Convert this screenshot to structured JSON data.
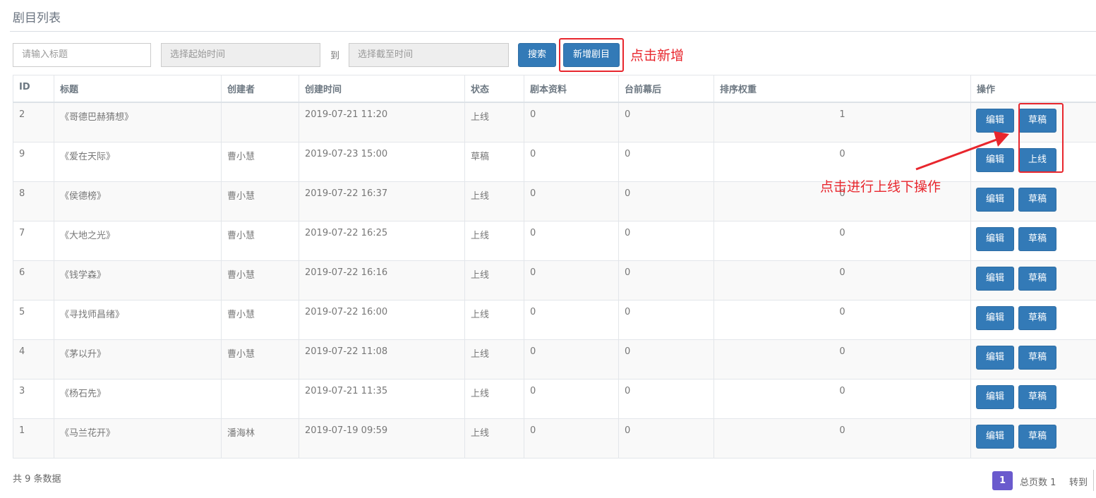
{
  "page": {
    "title": "剧目列表"
  },
  "search": {
    "title_placeholder": "请输入标题",
    "start_placeholder": "选择起始时间",
    "to_label": "到",
    "end_placeholder": "选择截至时间",
    "search_label": "搜索",
    "add_label": "新增剧目"
  },
  "annotations": {
    "add_note": "点击新增",
    "status_note": "点击进行上线下操作",
    "color": "#e8262d"
  },
  "table": {
    "headers": [
      "ID",
      "标题",
      "创建者",
      "创建时间",
      "状态",
      "剧本资料",
      "台前幕后",
      "排序权重",
      "操作"
    ],
    "rows": [
      {
        "id": "2",
        "title": "《哥德巴赫猜想》",
        "creator": "",
        "created": "2019-07-21 11:20",
        "status": "上线",
        "script": "0",
        "backstage": "0",
        "weight": "1",
        "edit": "编辑",
        "toggle": "草稿"
      },
      {
        "id": "9",
        "title": "《爱在天际》",
        "creator": "曹小慧",
        "created": "2019-07-23 15:00",
        "status": "草稿",
        "script": "0",
        "backstage": "0",
        "weight": "0",
        "edit": "编辑",
        "toggle": "上线"
      },
      {
        "id": "8",
        "title": "《侯德榜》",
        "creator": "曹小慧",
        "created": "2019-07-22 16:37",
        "status": "上线",
        "script": "0",
        "backstage": "0",
        "weight": "0",
        "edit": "编辑",
        "toggle": "草稿"
      },
      {
        "id": "7",
        "title": "《大地之光》",
        "creator": "曹小慧",
        "created": "2019-07-22 16:25",
        "status": "上线",
        "script": "0",
        "backstage": "0",
        "weight": "0",
        "edit": "编辑",
        "toggle": "草稿"
      },
      {
        "id": "6",
        "title": "《钱学森》",
        "creator": "曹小慧",
        "created": "2019-07-22 16:16",
        "status": "上线",
        "script": "0",
        "backstage": "0",
        "weight": "0",
        "edit": "编辑",
        "toggle": "草稿"
      },
      {
        "id": "5",
        "title": "《寻找师昌绪》",
        "creator": "曹小慧",
        "created": "2019-07-22 16:00",
        "status": "上线",
        "script": "0",
        "backstage": "0",
        "weight": "0",
        "edit": "编辑",
        "toggle": "草稿"
      },
      {
        "id": "4",
        "title": "《茅以升》",
        "creator": "曹小慧",
        "created": "2019-07-22 11:08",
        "status": "上线",
        "script": "0",
        "backstage": "0",
        "weight": "0",
        "edit": "编辑",
        "toggle": "草稿"
      },
      {
        "id": "3",
        "title": "《杨石先》",
        "creator": "",
        "created": "2019-07-21 11:35",
        "status": "上线",
        "script": "0",
        "backstage": "0",
        "weight": "0",
        "edit": "编辑",
        "toggle": "草稿"
      },
      {
        "id": "1",
        "title": "《马兰花开》",
        "creator": "潘海林",
        "created": "2019-07-19 09:59",
        "status": "上线",
        "script": "0",
        "backstage": "0",
        "weight": "0",
        "edit": "编辑",
        "toggle": "草稿"
      }
    ]
  },
  "footer": {
    "count_text": "共 9 条数据",
    "current_page": "1",
    "total_pages_text": "总页数 1",
    "goto_label": "转到"
  },
  "colors": {
    "primary": "#337ab7",
    "pager": "#6a5acd"
  }
}
